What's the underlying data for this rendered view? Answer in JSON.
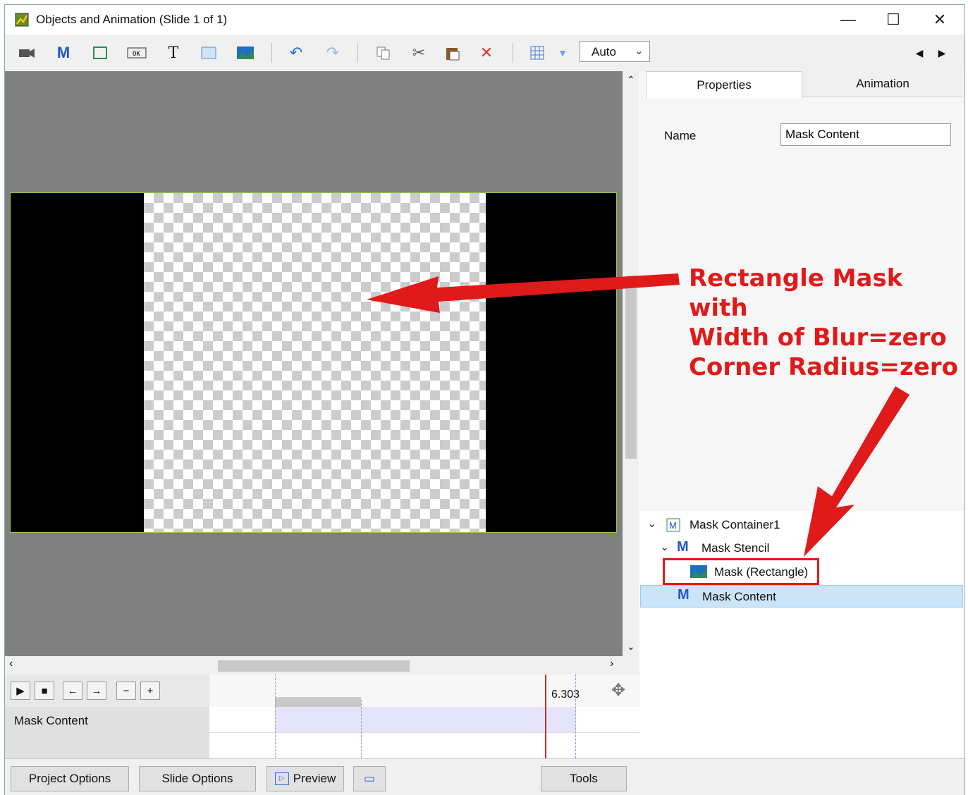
{
  "window": {
    "title": "Objects and Animation (Slide 1 of 1)",
    "minimize": "—",
    "maximize": "☐",
    "close": "✕"
  },
  "toolbar": {
    "zoom_value": "Auto",
    "nav_prev": "◀",
    "nav_next": "▶"
  },
  "properties": {
    "tabs": [
      "Properties",
      "Animation"
    ],
    "name_label": "Name",
    "name_value": "Mask Content"
  },
  "tree": {
    "items": [
      {
        "label": "Mask Container1",
        "icon": "mask-container-icon"
      },
      {
        "label": "Mask Stencil",
        "icon": "mask-stencil-icon"
      },
      {
        "label": "Mask (Rectangle)",
        "icon": "image-icon"
      },
      {
        "label": "Mask Content",
        "icon": "mask-content-icon"
      }
    ]
  },
  "timeline": {
    "time_marker": "6.303",
    "track_label": "Mask Content"
  },
  "bottom_buttons": {
    "project_options": "Project Options",
    "slide_options": "Slide Options",
    "preview": "Preview",
    "tools": "Tools"
  },
  "annotation": {
    "lines": [
      "Rectangle Mask",
      "with",
      "Width of Blur=zero",
      "Corner Radius=zero"
    ],
    "color": "#e01a1a"
  },
  "colors": {
    "selection": "#cce4f7",
    "canvas_bg": "#808080",
    "frame_border": "#9acd32"
  }
}
